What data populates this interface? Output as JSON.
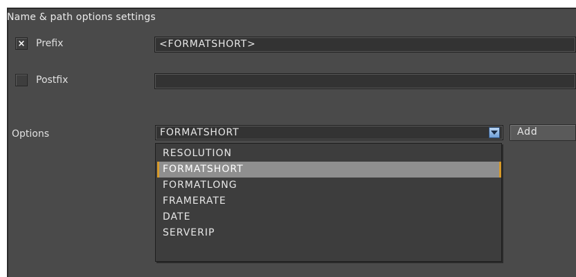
{
  "section": {
    "title": "Name & path options settings"
  },
  "prefix": {
    "label": "Prefix",
    "checked": true,
    "check_glyph": "×",
    "value": "<FORMATSHORT>"
  },
  "postfix": {
    "label": "Postfix",
    "checked": false,
    "check_glyph": "",
    "value": ""
  },
  "options": {
    "label": "Options",
    "selected": "FORMATSHORT",
    "add_label": "Add",
    "items": [
      "RESOLUTION",
      "FORMATSHORT",
      "FORMATLONG",
      "FRAMERATE",
      "DATE",
      "SERVERIP"
    ],
    "highlighted_index": 1
  },
  "colors": {
    "panel": "#4a4a4a",
    "field": "#333333",
    "highlight": "#8f8f8f",
    "highlight_border": "#d79a2a",
    "dropdown_arrow": "#6f9fd6"
  },
  "icons": {
    "check": "check-x-icon",
    "dropdown": "chevron-down-icon"
  }
}
